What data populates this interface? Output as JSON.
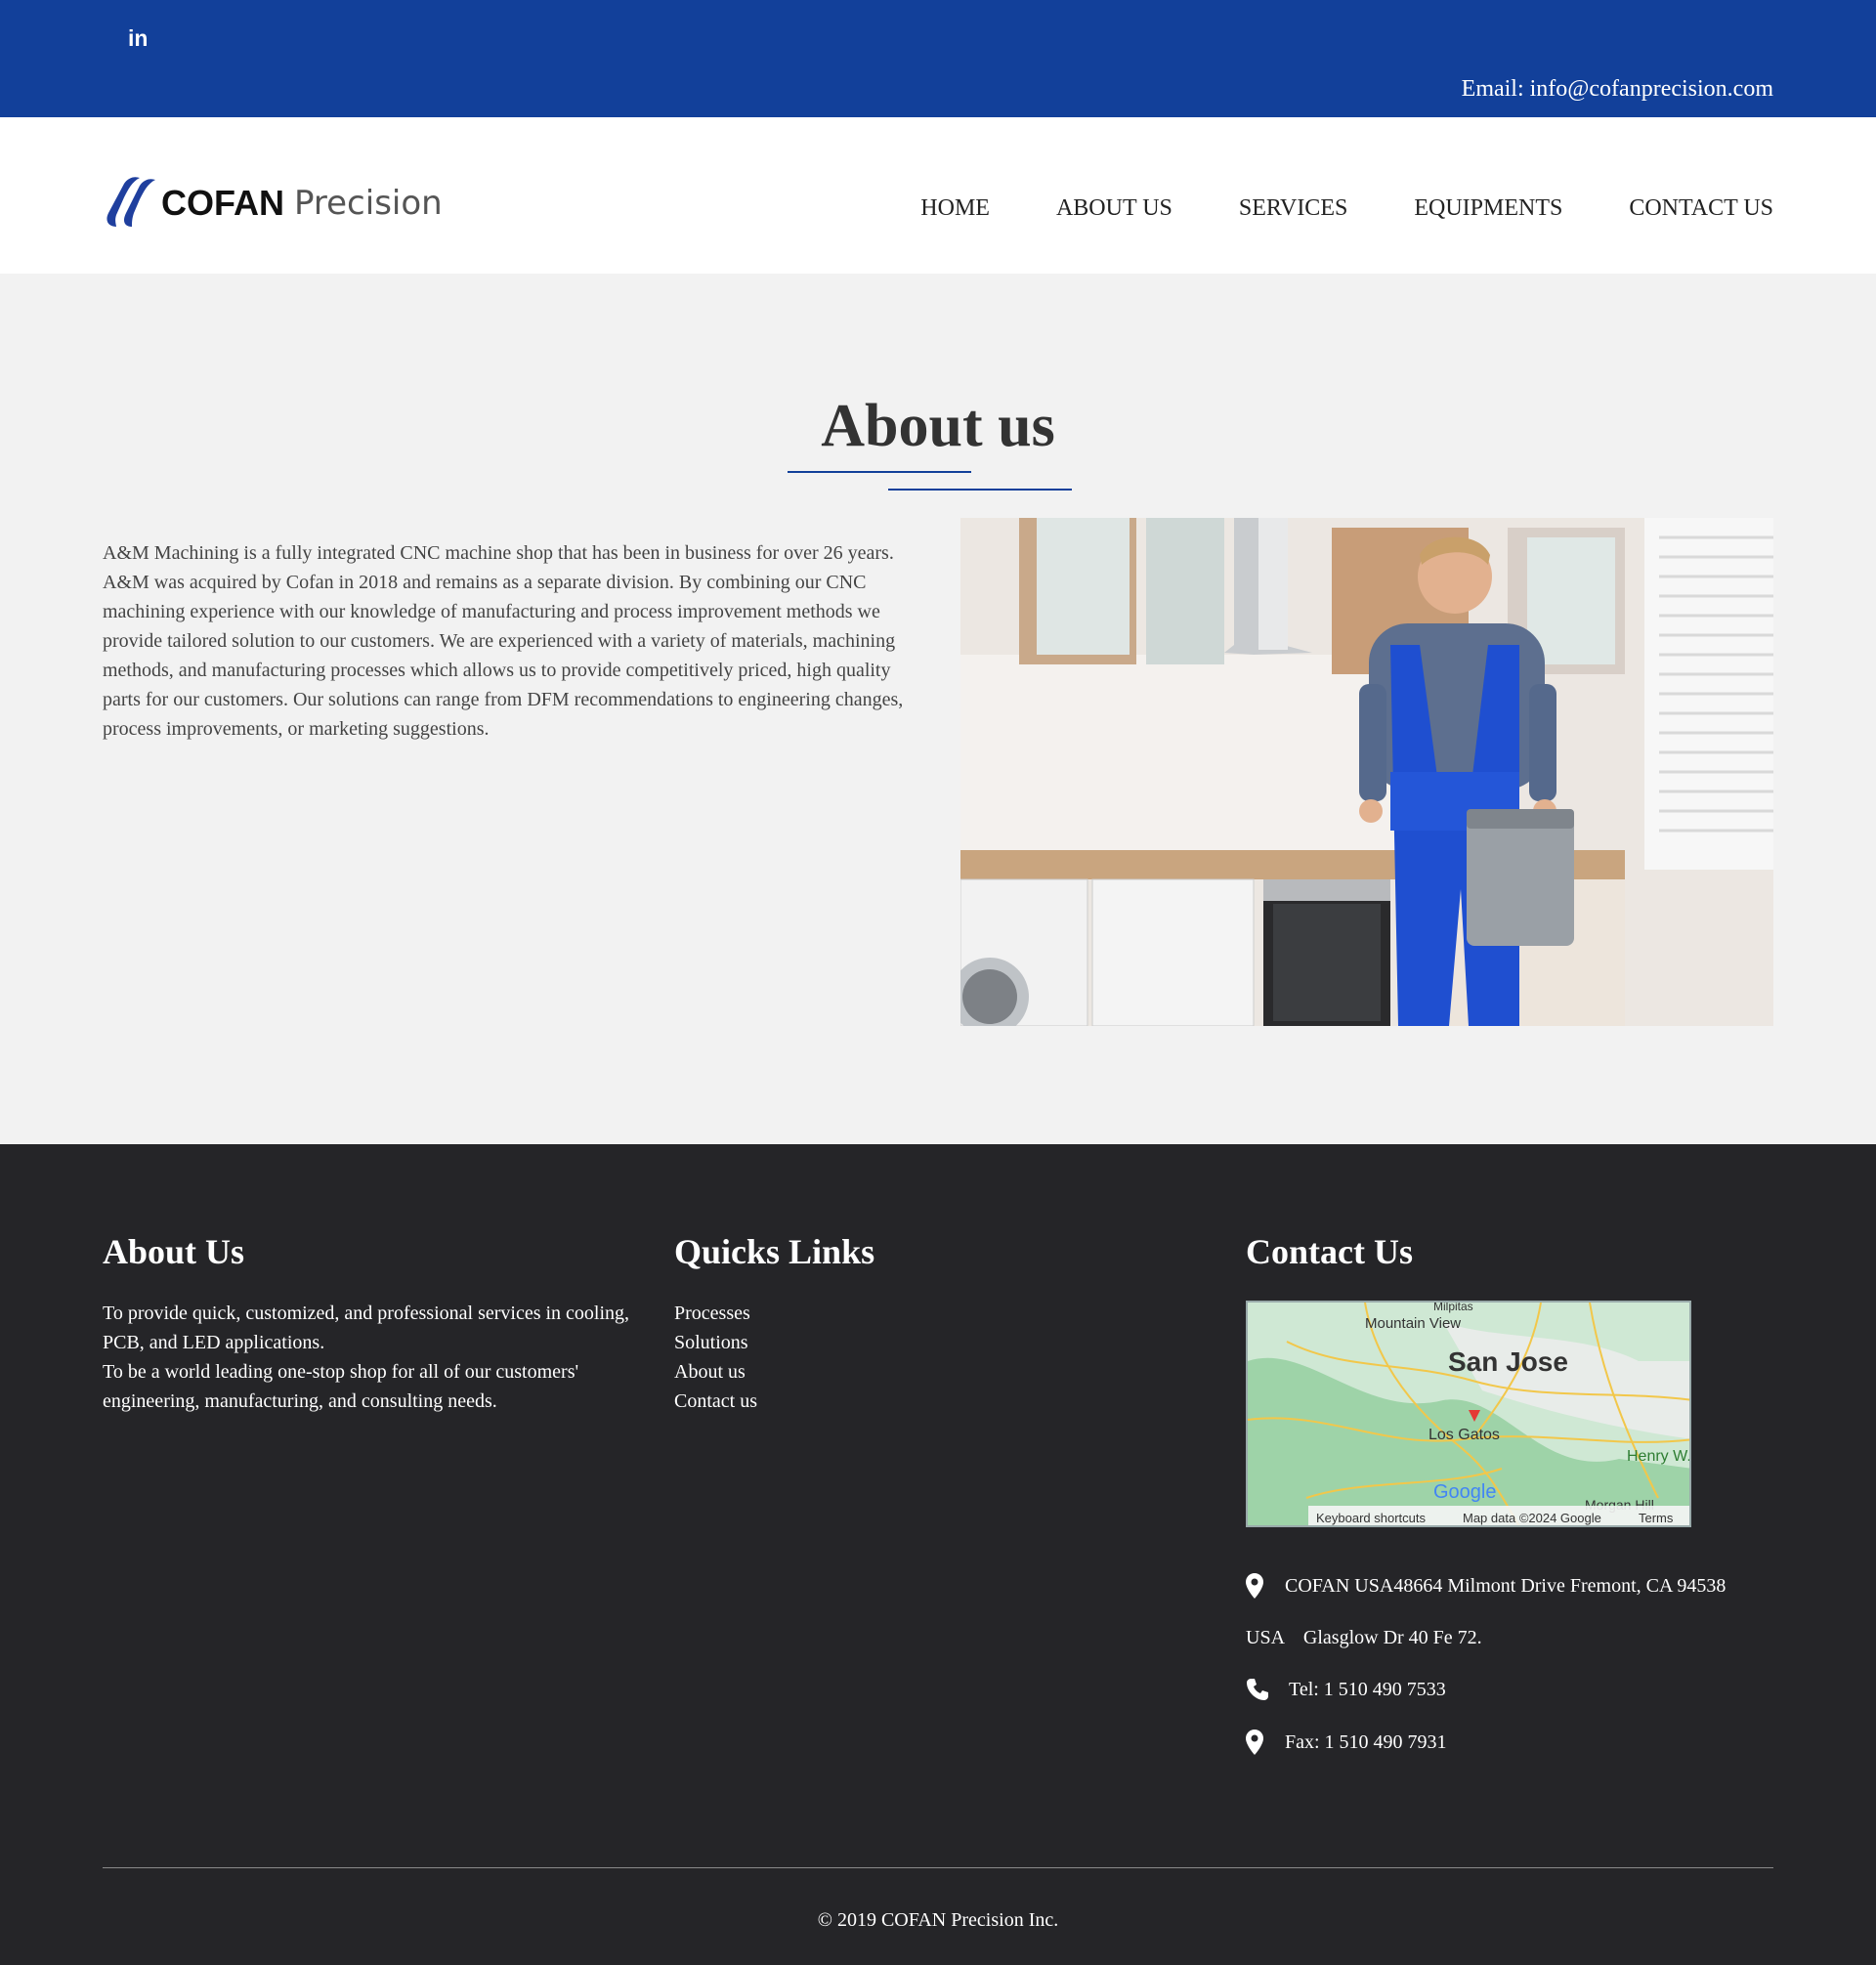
{
  "topbar": {
    "social_icon": "linkedin-icon",
    "social_label": "in",
    "email": "Email: info@cofanprecision.com"
  },
  "header": {
    "logo_brand": "COFAN",
    "logo_sub": "Precision",
    "nav": [
      "HOME",
      "ABOUT US",
      "SERVICES",
      "EQUIPMENTS",
      "CONTACT US"
    ]
  },
  "about": {
    "title": "About us",
    "body": "A&M Machining is a fully integrated CNC machine shop that has been in business for over 26 years. A&M was acquired by Cofan in 2018 and remains as a separate division. By combining our CNC machining experience with our knowledge of manufacturing and process improvement methods we provide tailored solution to our customers. We are experienced with a variety of materials, machining methods, and manufacturing processes which allows us to provide competitively priced, high quality parts for our customers. Our solutions can range from DFM recommendations to engineering changes, process improvements, or marketing suggestions."
  },
  "footer": {
    "about_heading": "About Us",
    "about_text": "To provide quick, customized, and professional services in cooling, PCB, and LED applications. To be a world leading one-stop shop for all of our customers' engineering, manufacturing, and consulting needs.",
    "about_line1": "To provide quick, customized, and professional services in cooling, PCB, and LED applications.",
    "about_line2": "To be a world leading one-stop shop for all of our customers' engineering, manufacturing, and consulting needs.",
    "links_heading": "Quicks Links",
    "links": [
      "Processes",
      "Solutions",
      "About us",
      "Contact us"
    ],
    "contact_heading": "Contact Us",
    "map": {
      "labels": [
        "Mountain View",
        "San Jose",
        "Los Gatos",
        "Henry W. State",
        "Morgan Hill",
        "Milpitas"
      ],
      "attribution": [
        "Keyboard shortcuts",
        "Map data ©2024 Google",
        "Terms"
      ],
      "google": "Google"
    },
    "address": "COFAN USA48664 Milmont Drive Fremont, CA 94538",
    "address2": "USA    Glasglow Dr 40 Fe 72.",
    "tel": "Tel: 1 510 490 7533",
    "fax": "Fax: 1 510 490 7931",
    "copyright": "© 2019 COFAN Precision Inc."
  },
  "colors": {
    "brand_blue": "#12409a",
    "footer_bg": "#252528",
    "page_bg": "#f2f2f2"
  }
}
